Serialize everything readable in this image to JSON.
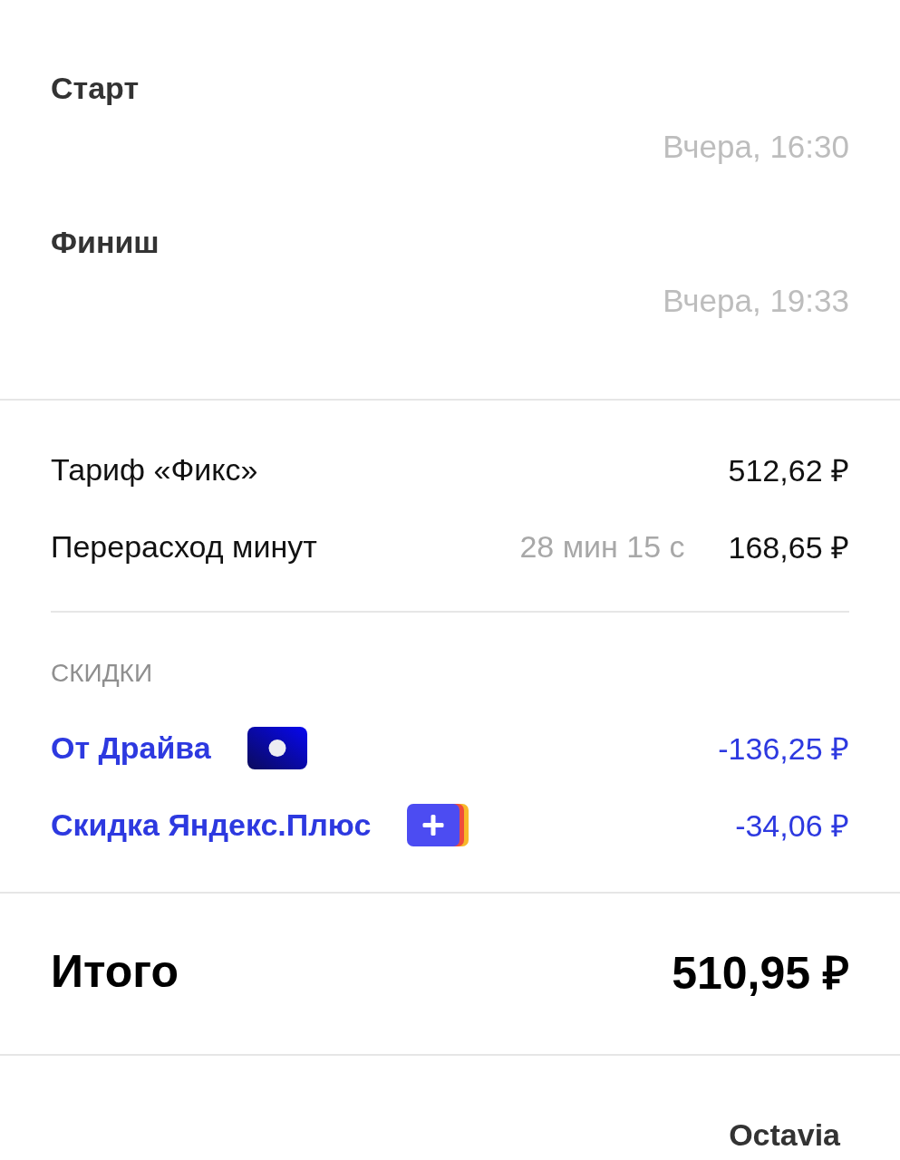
{
  "trip": {
    "points": [
      {
        "label": "Старт",
        "time": "Вчера, 16:30"
      },
      {
        "label": "Финиш",
        "time": "Вчера, 19:33"
      }
    ]
  },
  "charges": [
    {
      "label": "Тариф «Фикс»",
      "amount": "512,62 ₽"
    },
    {
      "label": "Перерасход минут",
      "detail": "28 мин 15 с",
      "amount": "168,65 ₽"
    }
  ],
  "discounts": {
    "heading": "СКИДКИ",
    "items": [
      {
        "label": "От Драйва",
        "kind": "dot",
        "amount": "-136,25 ₽"
      },
      {
        "label": "Скидка Яндекс.Плюс",
        "kind": "plus",
        "amount": "-34,06 ₽"
      }
    ]
  },
  "total": {
    "label": "Итого",
    "amount": "510,95 ₽"
  },
  "car": {
    "model": "Octavia"
  }
}
